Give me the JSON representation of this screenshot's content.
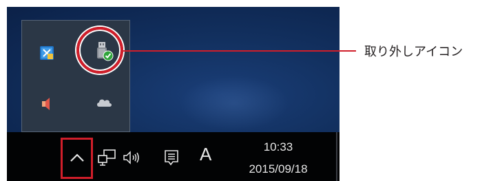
{
  "callout": {
    "label": "取り外しアイコン",
    "color": "#d01e2a"
  },
  "tray": {
    "icons": [
      {
        "name": "ime-pad-icon",
        "interactable": true
      },
      {
        "name": "usb-eject-icon",
        "interactable": true
      },
      {
        "name": "speaker-muted-icon",
        "interactable": true
      },
      {
        "name": "onedrive-cloud-icon",
        "interactable": true
      }
    ]
  },
  "taskbar": {
    "chevron_icon": "chevron-up-icon",
    "network_icon": "network-icon",
    "volume_icon": "volume-icon",
    "notification_icon": "action-center-icon",
    "ime_mode": "A",
    "clock": {
      "time": "10:33",
      "date": "2015/09/18"
    }
  },
  "colors": {
    "desktop": "#12305f",
    "tray_popup": "#2b3746",
    "taskbar": "#020304",
    "highlight": "#d01e2a"
  }
}
